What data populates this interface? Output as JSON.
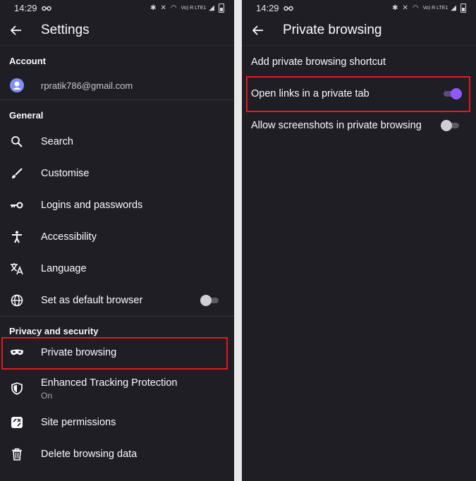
{
  "colors": {
    "background": "#1f1e25",
    "accent": "#9059ff",
    "highlight": "#e01a22",
    "text": "#fbfbfe",
    "muted": "#a9a8b1"
  },
  "left": {
    "status": {
      "time": "14:29",
      "signal": "Vo) R LTE1"
    },
    "title": "Settings",
    "account": {
      "section": "Account",
      "email": "rpratik786@gmail.com",
      "icon": "avatar-icon"
    },
    "general": {
      "section": "General",
      "items": [
        {
          "label": "Search",
          "icon": "search-icon"
        },
        {
          "label": "Customise",
          "icon": "brush-icon"
        },
        {
          "label": "Logins and passwords",
          "icon": "key-icon"
        },
        {
          "label": "Accessibility",
          "icon": "accessibility-icon"
        },
        {
          "label": "Language",
          "icon": "translate-icon"
        },
        {
          "label": "Set as default browser",
          "icon": "globe-icon",
          "toggle": false
        }
      ]
    },
    "privacy": {
      "section": "Privacy and security",
      "items": [
        {
          "label": "Private browsing",
          "icon": "mask-icon",
          "highlighted": true
        },
        {
          "label": "Enhanced Tracking Protection",
          "sub": "On",
          "icon": "shield-icon"
        },
        {
          "label": "Site permissions",
          "icon": "permissions-icon"
        },
        {
          "label": "Delete browsing data",
          "icon": "trash-icon"
        }
      ]
    }
  },
  "right": {
    "status": {
      "time": "14:29",
      "signal": "Vo) R LTE1"
    },
    "title": "Private browsing",
    "items": [
      {
        "label": "Add private browsing shortcut"
      },
      {
        "label": "Open links in a private tab",
        "toggle": true,
        "highlighted": true
      },
      {
        "label": "Allow screenshots in private browsing",
        "toggle": false
      }
    ]
  }
}
